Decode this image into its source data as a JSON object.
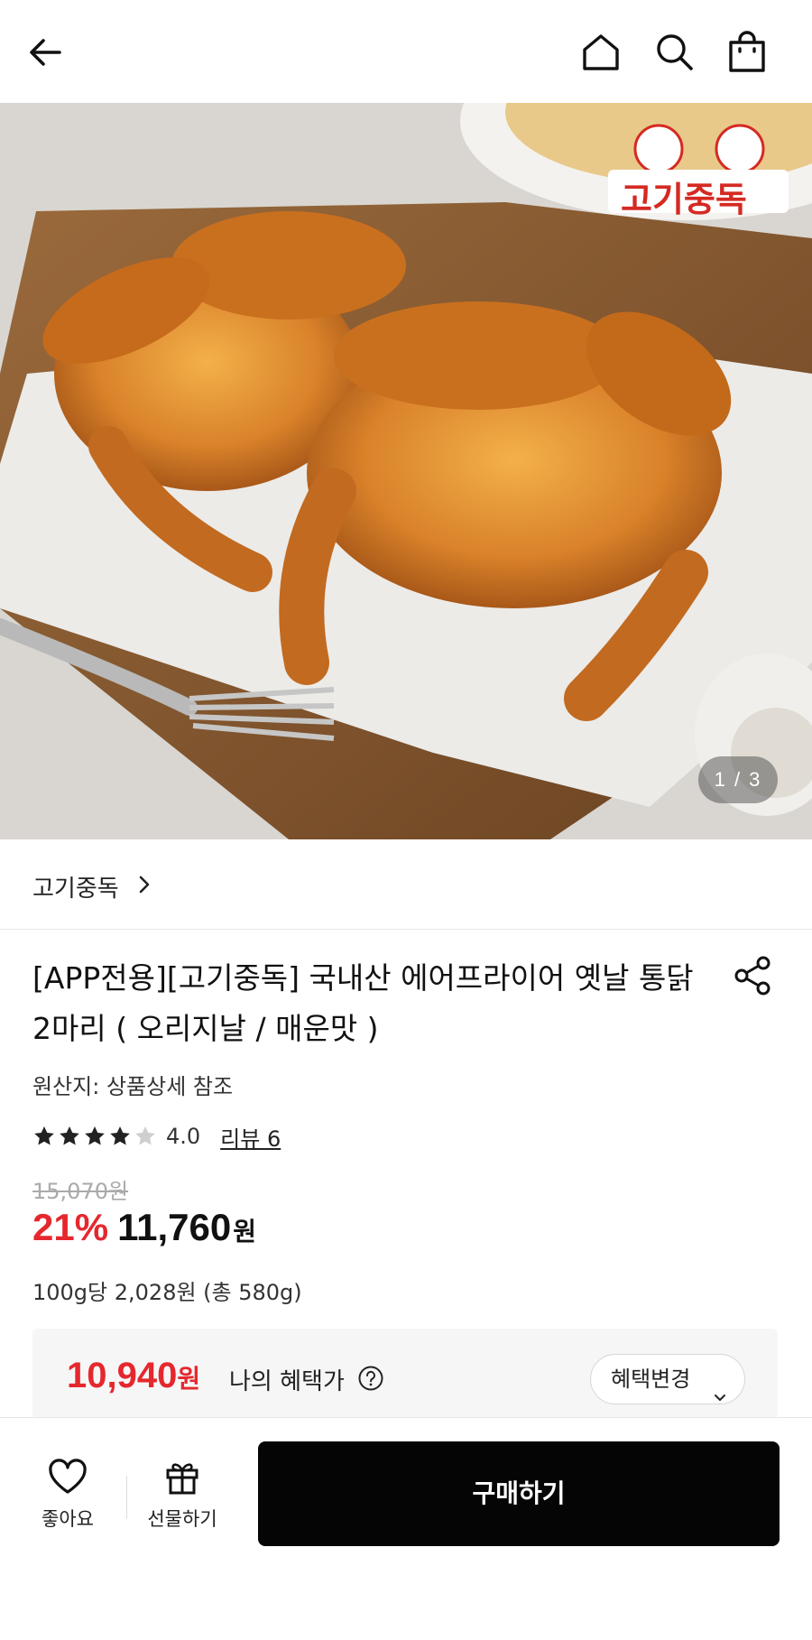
{
  "header": {
    "back_icon": "arrow-left-icon",
    "home_icon": "home-icon",
    "search_icon": "search-icon",
    "bag_icon": "shopping-bag-icon"
  },
  "hero": {
    "pager": "1 / 3",
    "logo_text": "고기중독"
  },
  "brand": {
    "name": "고기중독",
    "chevron_icon": "chevron-right-icon"
  },
  "product": {
    "title": "[APP전용][고기중독] 국내산 에어프라이어 옛날 통닭 2마리 ( 오리지날 / 매운맛 )",
    "share_icon": "share-icon",
    "origin": "원산지: 상품상세 참조",
    "rating": {
      "stars": 4,
      "max_stars": 5,
      "value": "4.0",
      "review_link": "리뷰 6"
    },
    "original_price": "15,070원",
    "discount": "21%",
    "price": "11,760",
    "price_unit": "원",
    "unit_price": "100g당 2,028원 (총 580g)"
  },
  "benefit": {
    "price": "10,940",
    "price_unit": "원",
    "label": "나의 혜택가",
    "help_icon": "question-circle-icon",
    "change_button": "혜택변경"
  },
  "bottom": {
    "like_label": "좋아요",
    "gift_label": "선물하기",
    "buy_label": "구매하기"
  },
  "colors": {
    "accent_red": "#e5282e",
    "buy_button": "#050505"
  }
}
